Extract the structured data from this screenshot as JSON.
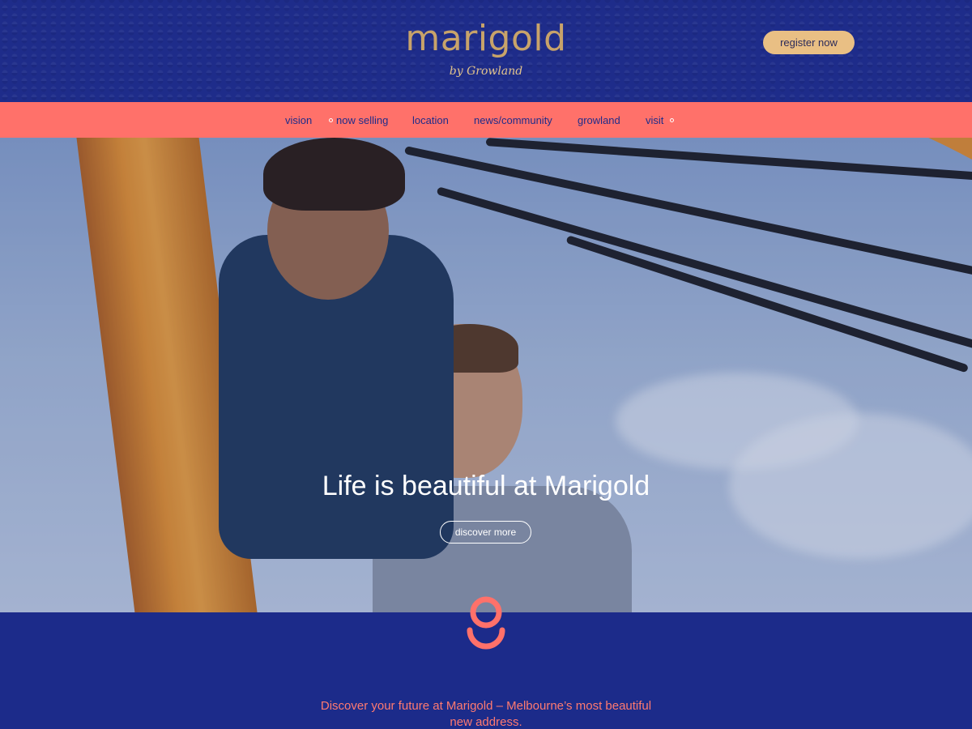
{
  "header": {
    "logo": "marigold",
    "logo_sub": "by Growland",
    "register_label": "register now"
  },
  "nav": {
    "items": [
      {
        "label": "vision"
      },
      {
        "label": "now selling"
      },
      {
        "label": "location"
      },
      {
        "label": "news/community"
      },
      {
        "label": "growland"
      },
      {
        "label": "visit"
      }
    ]
  },
  "hero": {
    "title": "Life is beautiful at Marigold",
    "cta_label": "discover more"
  },
  "section": {
    "emblem_icon": "marigold-g-icon",
    "text": "Discover your future at Marigold – Melbourne’s most beautiful new address."
  },
  "colors": {
    "navy": "#1e2c8a",
    "coral": "#ff716a",
    "gold": "#c8a36a",
    "button_gold": "#e9bf84"
  }
}
